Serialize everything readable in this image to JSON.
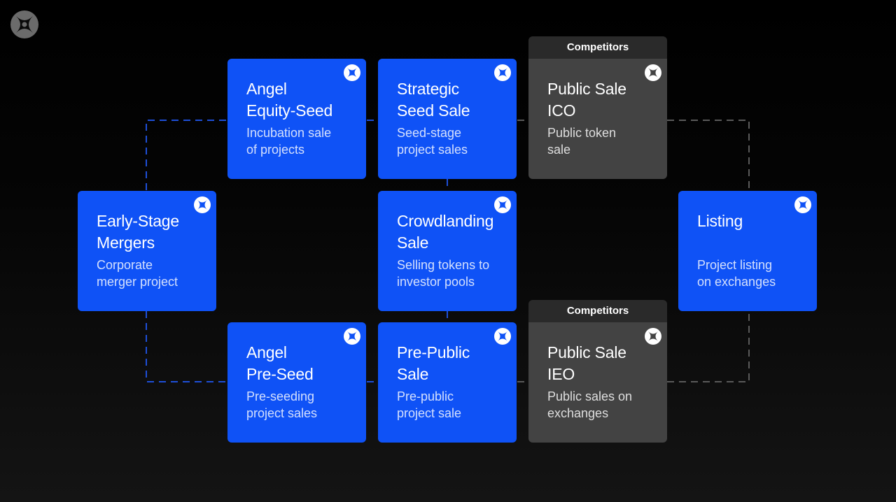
{
  "competitor_label": "Competitors",
  "colors": {
    "blue_card": "#0f52f6",
    "gray_card": "#434343",
    "competitor_tab": "#2a2a2a",
    "connector_blue": "#1e4fd8",
    "connector_gray": "#5a5a5a",
    "background": "#000000"
  },
  "icon": "x-circle-logo-icon",
  "cards": {
    "early_stage_mergers": {
      "title": "Early-Stage\nMergers",
      "desc": "Corporate\nmerger project"
    },
    "angel_equity_seed": {
      "title": "Angel\nEquity-Seed",
      "desc": "Incubation sale\nof projects"
    },
    "strategic_seed_sale": {
      "title": "Strategic\nSeed Sale",
      "desc": "Seed-stage\nproject sales"
    },
    "public_sale_ico": {
      "title": "Public Sale\nICO",
      "desc": "Public token\nsale"
    },
    "crowdlanding_sale": {
      "title": "Crowdlanding\nSale",
      "desc": "Selling tokens to\ninvestor pools"
    },
    "listing": {
      "title": "Listing",
      "desc": "Project listing\non exchanges"
    },
    "angel_pre_seed": {
      "title": "Angel\nPre-Seed",
      "desc": "Pre-seeding\nproject sales"
    },
    "pre_public_sale": {
      "title": "Pre-Public\nSale",
      "desc": "Pre-public\nproject sale"
    },
    "public_sale_ieo": {
      "title": "Public Sale\nIEO",
      "desc": "Public sales on\nexchanges"
    }
  }
}
